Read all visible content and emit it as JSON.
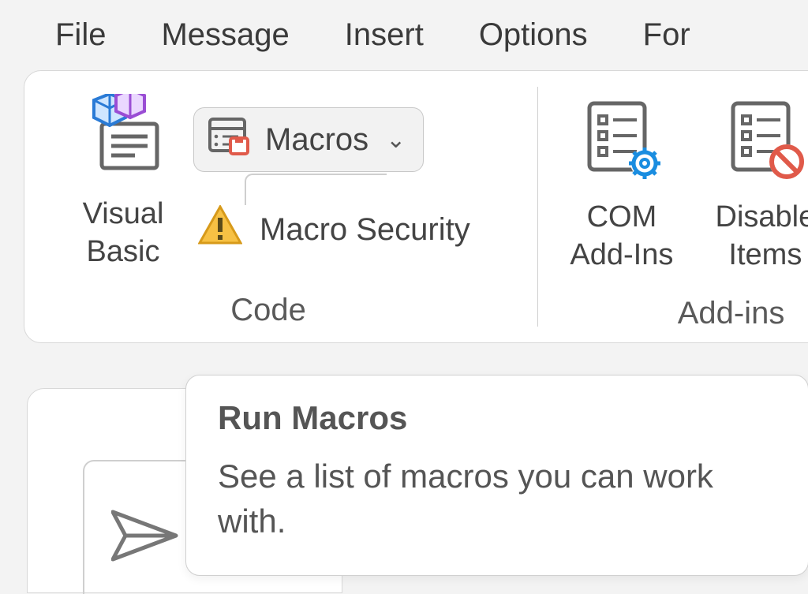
{
  "menubar": {
    "items": [
      "File",
      "Message",
      "Insert",
      "Options",
      "For"
    ]
  },
  "ribbon": {
    "groups": {
      "code": {
        "label": "Code",
        "visual_basic": {
          "label": "Visual\nBasic"
        },
        "macros": {
          "label": "Macros"
        },
        "macro_security": {
          "label": "Macro Security"
        }
      },
      "addins": {
        "label": "Add-ins",
        "com": {
          "label": "COM\nAdd-Ins"
        },
        "disabled": {
          "label": "Disable\nItems"
        }
      }
    }
  },
  "tooltip": {
    "title": "Run Macros",
    "body": "See a list of macros you can work with."
  }
}
